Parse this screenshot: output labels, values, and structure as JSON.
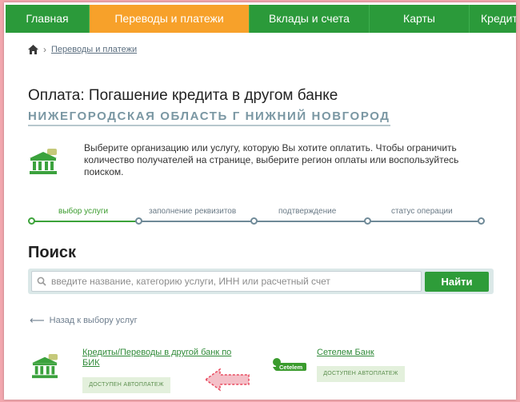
{
  "nav": {
    "items": [
      {
        "label": "Главная"
      },
      {
        "label": "Переводы и платежи"
      },
      {
        "label": "Вклады и счета"
      },
      {
        "label": "Карты"
      },
      {
        "label": "Кредиты"
      }
    ]
  },
  "breadcrumb": {
    "link": "Переводы и платежи"
  },
  "page": {
    "title": "Оплата: Погашение кредита в другом банке",
    "region": "НИЖЕГОРОДСКАЯ ОБЛАСТЬ Г НИЖНИЙ НОВГОРОД",
    "info": "Выберите организацию или услугу, которую Вы хотите оплатить. Чтобы ограничить количество получателей на странице, выберите регион оплаты или воспользуйтесь поиском."
  },
  "steps": [
    {
      "label": "выбор услуги"
    },
    {
      "label": "заполнение реквизитов"
    },
    {
      "label": "подтверждение"
    },
    {
      "label": "статус операции"
    }
  ],
  "search": {
    "title": "Поиск",
    "placeholder": "введите название, категорию услуги, ИНН или расчетный счет",
    "button": "Найти"
  },
  "back_link": "Назад к выбору услуг",
  "results": [
    {
      "label": "Кредиты/Переводы в другой банк по БИК",
      "badge": "ДОСТУПЕН АВТОПЛАТЕЖ"
    },
    {
      "label": "Сетелем Банк",
      "badge": "ДОСТУПЕН АВТОПЛАТЕЖ",
      "logo_text": "Cetelem"
    }
  ],
  "colors": {
    "brand_green": "#2b9a3a",
    "active_tab": "#f7a12a",
    "frame": "#f2a7ae",
    "hint_arrow": "#e84a5f"
  }
}
